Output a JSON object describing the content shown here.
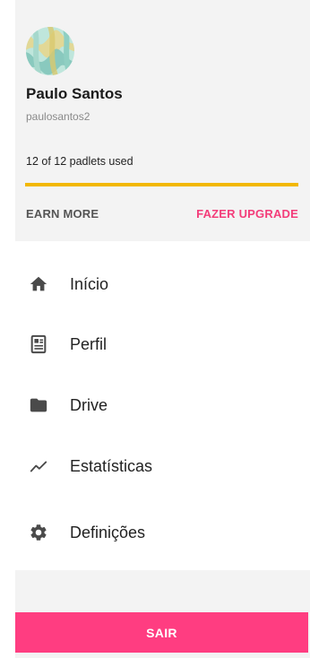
{
  "account": {
    "avatar_icon": "wave-avatar-image",
    "name": "Paulo Santos",
    "username": "paulosantos2",
    "usage_text": "12 of 12 padlets used",
    "usage_fraction": 1.0,
    "earn_more_label": "EARN MORE",
    "upgrade_label": "FAZER UPGRADE"
  },
  "menu": {
    "items": [
      {
        "label": "Início",
        "icon": "home-icon"
      },
      {
        "label": "Perfil",
        "icon": "profile-card-icon"
      },
      {
        "label": "Drive",
        "icon": "folder-icon"
      },
      {
        "label": "Estatísticas",
        "icon": "trending-up-icon"
      },
      {
        "label": "Definições",
        "icon": "gear-icon"
      }
    ]
  },
  "logout_label": "SAIR",
  "colors": {
    "accent": "#ff3d81",
    "upgrade": "#f33d7a",
    "progress": "#f2b800",
    "panel": "#f3f3f3"
  }
}
